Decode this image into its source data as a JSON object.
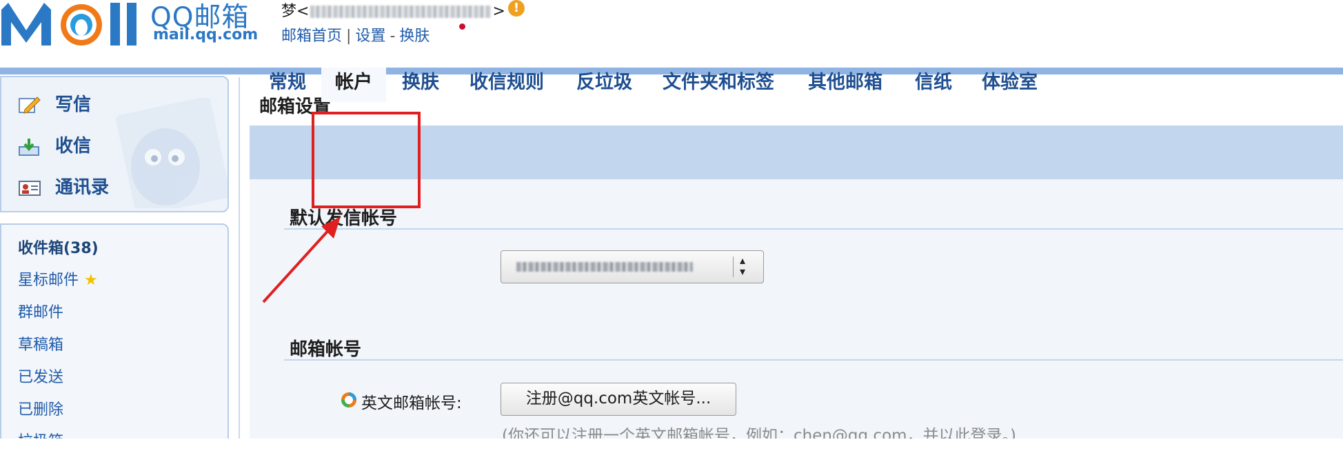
{
  "header": {
    "logo_text": "QQ邮箱",
    "logo_sub": "mail.qq.com",
    "user_prefix": "梦<",
    "user_suffix": ">",
    "warning_symbol": "!",
    "links": [
      "邮箱首页",
      "设置",
      "换肤"
    ],
    "separators": [
      "|",
      "-"
    ]
  },
  "sidebar": {
    "actions": [
      {
        "label": "写信",
        "icon": "compose-icon"
      },
      {
        "label": "收信",
        "icon": "inbox-download-icon"
      },
      {
        "label": "通讯录",
        "icon": "contacts-card-icon"
      }
    ],
    "folders": [
      {
        "label": "收件箱(38)",
        "bold": true
      },
      {
        "label": "星标邮件",
        "star": "★"
      },
      {
        "label": "群邮件"
      },
      {
        "label": "草稿箱"
      },
      {
        "label": "已发送"
      },
      {
        "label": "已删除"
      },
      {
        "label": "垃圾箱"
      }
    ]
  },
  "main": {
    "title": "邮箱设置",
    "tabs": [
      "常规",
      "帐户",
      "换肤",
      "收信规则",
      "反垃圾",
      "文件夹和标签",
      "其他邮箱",
      "信纸",
      "体验室"
    ],
    "active_tab": "帐户",
    "section_default_sender": "默认发信帐号",
    "section_mail_account": "邮箱帐号",
    "english_account_label": "英文邮箱帐号:",
    "register_button": "注册@qq.com英文帐号...",
    "hint": "(你还可以注册一个英文邮箱帐号，例如：chen@qq.com，并以此登录。)"
  },
  "colors": {
    "brand_blue": "#2b78c5",
    "annotation_red": "#e02020",
    "tab_bar": "#c2d6ee"
  }
}
